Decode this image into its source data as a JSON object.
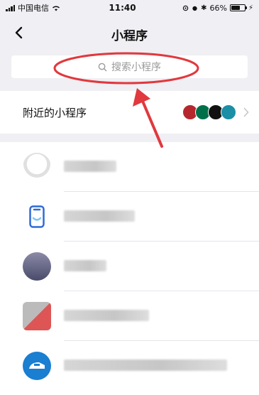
{
  "status_bar": {
    "carrier": "中国电信",
    "time": "11:40",
    "battery_percent": "66%",
    "battery_level": 0.66
  },
  "nav": {
    "title": "小程序",
    "back_icon": "chevron-left-icon"
  },
  "search": {
    "placeholder": "搜索小程序",
    "icon": "search-icon"
  },
  "nearby": {
    "label": "附近的小程序",
    "logo_colors": [
      "#b5272d",
      "#00704a",
      "#111111",
      "#1a8fa6"
    ]
  },
  "list": {
    "items": [
      {
        "icon": "penguin-mascot-icon",
        "color": "#e0e0e0"
      },
      {
        "icon": "phone-smile-icon",
        "color": "#2f6bd8"
      },
      {
        "icon": "person-silhouette-icon",
        "color": "#4a4a6a"
      },
      {
        "icon": "app-icon",
        "color": "#c9c9c9"
      },
      {
        "icon": "train-icon",
        "color": "#1a7ed1"
      }
    ]
  },
  "annotation": {
    "color": "#e0393e"
  }
}
